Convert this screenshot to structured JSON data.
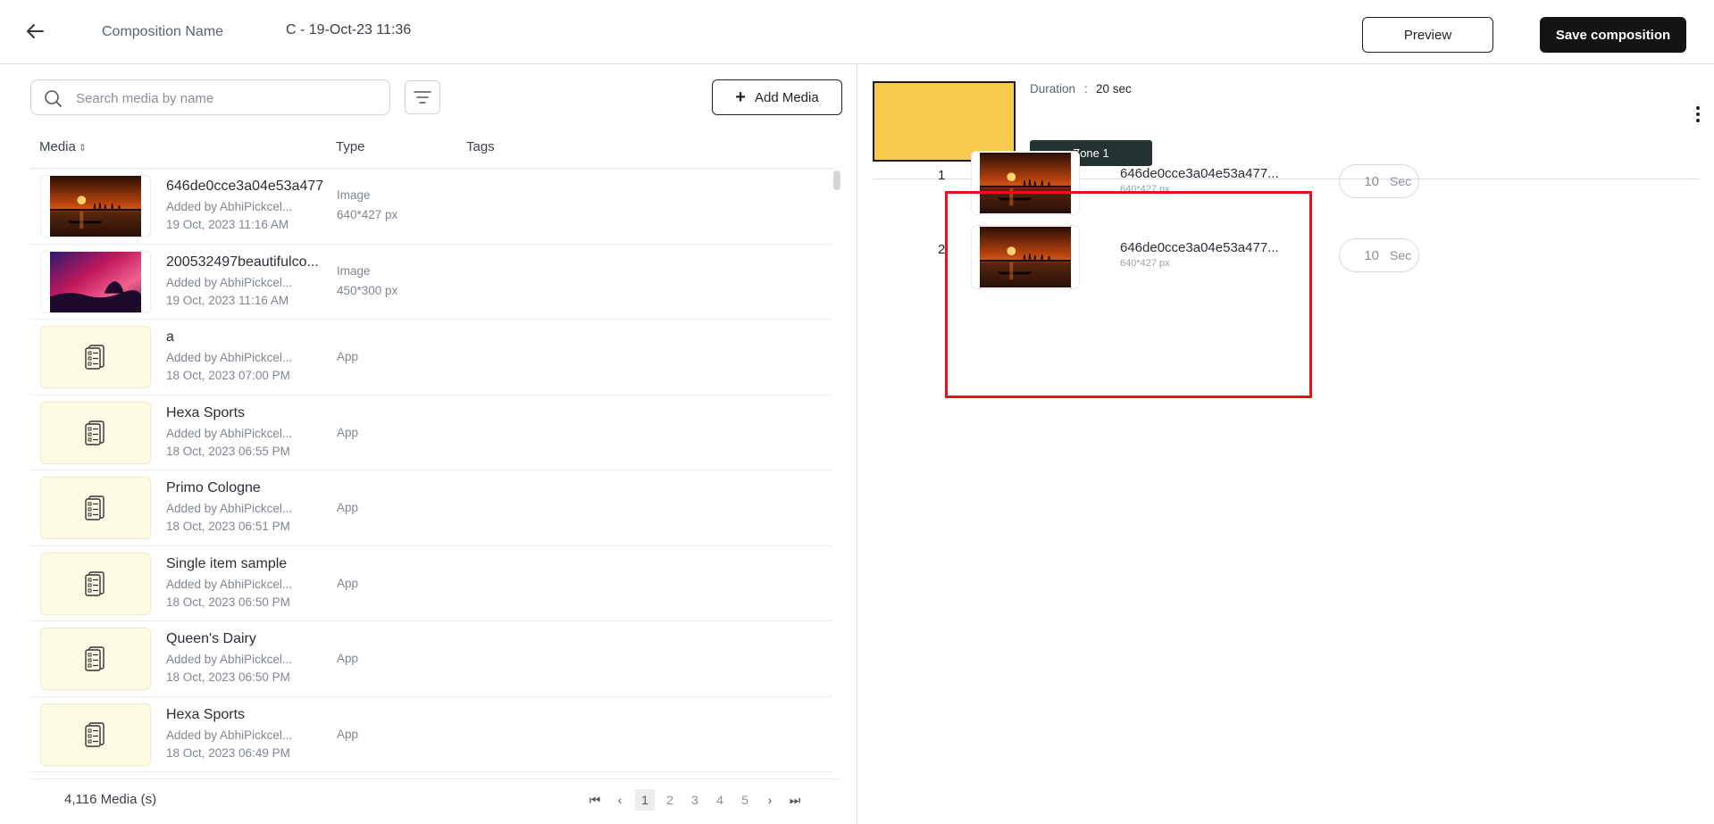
{
  "header": {
    "composition_label": "Composition Name",
    "composition_value": "C - 19-Oct-23 11:36",
    "preview_label": "Preview",
    "save_label": "Save composition"
  },
  "library": {
    "search_placeholder": "Search media by name",
    "add_media_label": "Add Media",
    "columns": {
      "media": "Media",
      "type": "Type",
      "tags": "Tags"
    },
    "rows": [
      {
        "title": "646de0cce3a04e53a477",
        "added_by": "Added by AbhiPickcel...",
        "date": "19 Oct, 2023 11:16 AM",
        "type": "Image",
        "size": "640*427 px",
        "thumb": "sunset-lake"
      },
      {
        "title": "200532497beautifulco...",
        "added_by": "Added by AbhiPickcel...",
        "date": "19 Oct, 2023 11:16 AM",
        "type": "Image",
        "size": "450*300 px",
        "thumb": "pink-sky"
      },
      {
        "title": "a",
        "added_by": "Added by AbhiPickcel...",
        "date": "18 Oct, 2023 07:00 PM",
        "type": "App",
        "thumb": "app-icon"
      },
      {
        "title": "Hexa Sports",
        "added_by": "Added by AbhiPickcel...",
        "date": "18 Oct, 2023 06:55 PM",
        "type": "App",
        "thumb": "app-icon"
      },
      {
        "title": "Primo Cologne",
        "added_by": "Added by AbhiPickcel...",
        "date": "18 Oct, 2023 06:51 PM",
        "type": "App",
        "thumb": "app-icon"
      },
      {
        "title": "Single item sample",
        "added_by": "Added by AbhiPickcel...",
        "date": "18 Oct, 2023 06:50 PM",
        "type": "App",
        "thumb": "app-icon"
      },
      {
        "title": "Queen's Dairy",
        "added_by": "Added by AbhiPickcel...",
        "date": "18 Oct, 2023 06:50 PM",
        "type": "App",
        "thumb": "app-icon"
      },
      {
        "title": "Hexa Sports",
        "added_by": "Added by AbhiPickcel...",
        "date": "18 Oct, 2023 06:49 PM",
        "type": "App",
        "thumb": "app-icon"
      }
    ],
    "count_label": "4,116 Media (s)",
    "pagination": {
      "pages": [
        "1",
        "2",
        "3",
        "4",
        "5"
      ],
      "current": "1"
    }
  },
  "zone": {
    "duration_label": "Duration",
    "duration_sep": ":",
    "duration_value": "20 sec",
    "tab_label": "Zone 1",
    "preview_color": "#f7c94d",
    "playlist": [
      {
        "index": "1",
        "name": "646de0cce3a04e53a477...",
        "size": "640*427 px",
        "duration": "10",
        "unit": "Sec"
      },
      {
        "index": "2",
        "name": "646de0cce3a04e53a477...",
        "size": "640*427 px",
        "duration": "10",
        "unit": "Sec"
      }
    ]
  },
  "colors": {
    "highlight": "#e8101a",
    "save_button": "#141414",
    "zone_tab": "#233331"
  }
}
